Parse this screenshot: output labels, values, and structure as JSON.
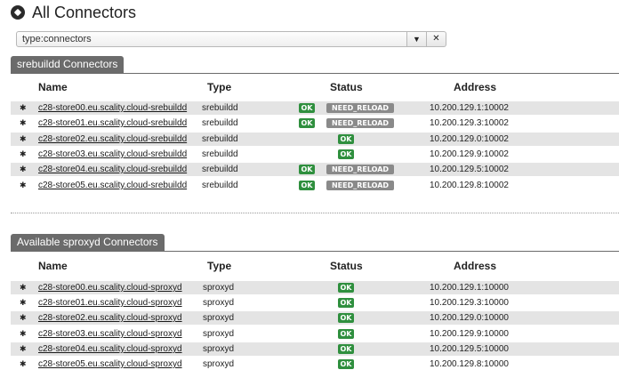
{
  "header": {
    "title": "All Connectors"
  },
  "filter": {
    "value": "type:connectors",
    "dropdown_glyph": "▼",
    "clear_glyph": "✕"
  },
  "columns": {
    "name": "Name",
    "type": "Type",
    "status": "Status",
    "address": "Address"
  },
  "sections": [
    {
      "title": "srebuildd Connectors",
      "rows": [
        {
          "name": "c28-store00.eu.scality.cloud-srebuildd",
          "type": "srebuildd",
          "status": [
            "OK",
            "NEED_RELOAD"
          ],
          "address": "10.200.129.1:10002"
        },
        {
          "name": "c28-store01.eu.scality.cloud-srebuildd",
          "type": "srebuildd",
          "status": [
            "OK",
            "NEED_RELOAD"
          ],
          "address": "10.200.129.3:10002"
        },
        {
          "name": "c28-store02.eu.scality.cloud-srebuildd",
          "type": "srebuildd",
          "status": [
            "OK"
          ],
          "address": "10.200.129.0:10002"
        },
        {
          "name": "c28-store03.eu.scality.cloud-srebuildd",
          "type": "srebuildd",
          "status": [
            "OK"
          ],
          "address": "10.200.129.9:10002"
        },
        {
          "name": "c28-store04.eu.scality.cloud-srebuildd",
          "type": "srebuildd",
          "status": [
            "OK",
            "NEED_RELOAD"
          ],
          "address": "10.200.129.5:10002"
        },
        {
          "name": "c28-store05.eu.scality.cloud-srebuildd",
          "type": "srebuildd",
          "status": [
            "OK",
            "NEED_RELOAD"
          ],
          "address": "10.200.129.8:10002"
        }
      ]
    },
    {
      "title": "Available sproxyd Connectors",
      "rows": [
        {
          "name": "c28-store00.eu.scality.cloud-sproxyd",
          "type": "sproxyd",
          "status": [
            "OK"
          ],
          "address": "10.200.129.1:10000"
        },
        {
          "name": "c28-store01.eu.scality.cloud-sproxyd",
          "type": "sproxyd",
          "status": [
            "OK"
          ],
          "address": "10.200.129.3:10000"
        },
        {
          "name": "c28-store02.eu.scality.cloud-sproxyd",
          "type": "sproxyd",
          "status": [
            "OK"
          ],
          "address": "10.200.129.0:10000"
        },
        {
          "name": "c28-store03.eu.scality.cloud-sproxyd",
          "type": "sproxyd",
          "status": [
            "OK"
          ],
          "address": "10.200.129.9:10000"
        },
        {
          "name": "c28-store04.eu.scality.cloud-sproxyd",
          "type": "sproxyd",
          "status": [
            "OK"
          ],
          "address": "10.200.129.5:10000"
        },
        {
          "name": "c28-store05.eu.scality.cloud-sproxyd",
          "type": "sproxyd",
          "status": [
            "OK"
          ],
          "address": "10.200.129.8:10000"
        }
      ]
    }
  ],
  "icons": {
    "header": "connector-icon",
    "row": "pin-icon"
  },
  "colors": {
    "ok_badge": "#2f8f3e",
    "reload_badge": "#8a8a8a",
    "section_header": "#6b6b6b",
    "row_alt": "#e4e4e4"
  }
}
